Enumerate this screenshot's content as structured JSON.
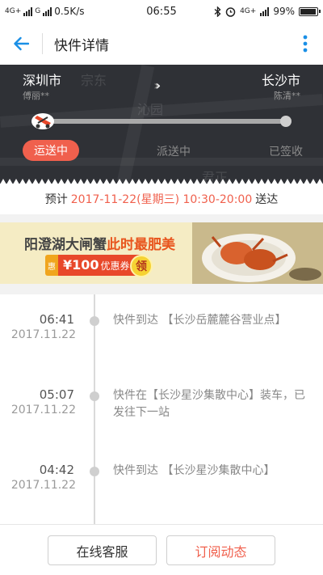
{
  "status_bar": {
    "network_left_1": "4G+",
    "network_left_2": "G",
    "speed": "0.5K/s",
    "time": "06:55",
    "network_right": "4G+",
    "battery": "99%",
    "battery_level": 0.99
  },
  "header": {
    "title": "快件详情",
    "back_icon": "arrow-left-icon",
    "more_icon": "more-vertical-icon"
  },
  "route": {
    "from_city": "深圳市",
    "from_person": "傅丽**",
    "to_city": "长沙市",
    "to_person": "陈清**",
    "direction_glyph": ">>>",
    "stages": [
      "运送中",
      "派送中",
      "已签收"
    ],
    "active_stage": "运送中",
    "map_labels": [
      "宗东",
      "沁园",
      "君正"
    ]
  },
  "estimate": {
    "prefix": "预计",
    "time": "2017-11-22(星期三) 10:30-20:00",
    "suffix": "送达"
  },
  "banner": {
    "title_plain": "阳澄湖大闸蟹",
    "title_highlight": "此时最肥美",
    "badge": "惠",
    "coupon_amount": "¥100",
    "coupon_label": "优惠券",
    "claim": "领"
  },
  "timeline": [
    {
      "time": "06:41",
      "date": "2017.11.22",
      "text": "快件到达 【长沙岳麓麓谷营业点】"
    },
    {
      "time": "05:07",
      "date": "2017.11.22",
      "text": "快件在【长沙星沙集散中心】装车，已发往下一站"
    },
    {
      "time": "04:42",
      "date": "2017.11.22",
      "text": "快件到达 【长沙星沙集散中心】"
    }
  ],
  "actions": {
    "customer_service": "在线客服",
    "subscribe": "订阅动态"
  },
  "colors": {
    "accent_red": "#f0604d",
    "back_blue": "#1a8fe6",
    "map_bg": "#2f3136",
    "banner_bg": "#f5ecc4"
  }
}
